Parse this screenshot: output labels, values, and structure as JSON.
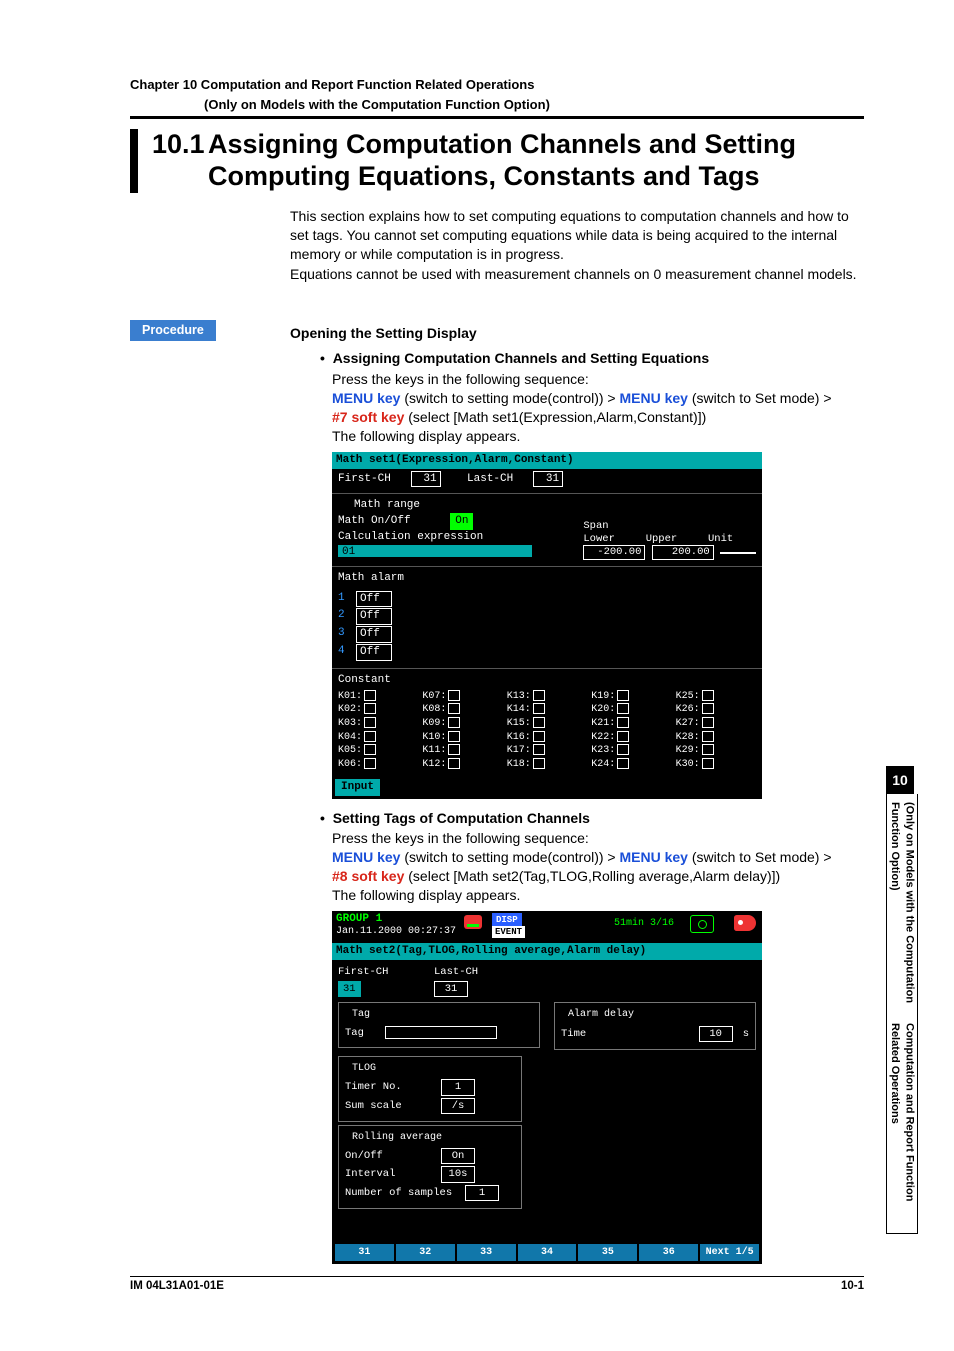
{
  "running_header": {
    "line1": "Chapter 10 Computation and Report Function Related Operations",
    "line2": "(Only on Models with the Computation Function Option)"
  },
  "section": {
    "number": "10.1",
    "title_line1": "Assigning Computation Channels and Setting",
    "title_line2": "Computing Equations, Constants and Tags"
  },
  "intro": {
    "p1": "This section explains how to set computing equations to computation channels and how to set tags.  You cannot set computing equations while data is being acquired to the internal memory or while computation is in progress.",
    "p2": "Equations cannot be used with measurement channels on 0 measurement channel models."
  },
  "procedure_label": "Procedure",
  "opening_heading": "Opening the Setting Display",
  "bullet1": {
    "title": "Assigning Computation Channels and Setting Equations",
    "text1": "Press the keys in the following sequence:",
    "seq_menu1": "MENU key",
    "seq_t1": " (switch to setting mode(control)) > ",
    "seq_menu2": "MENU key",
    "seq_t2": " (switch to Set mode) > ",
    "seq_soft": "#7 soft key",
    "seq_t3": " (select [Math set1(Expression,Alarm,Constant)])",
    "text2": "The following display appears."
  },
  "lcd1": {
    "title_bar": "Math set1(Expression,Alarm,Constant)",
    "first_ch_label": "First-CH",
    "first_ch_value": "31",
    "last_ch_label": "Last-CH",
    "last_ch_value": "31",
    "math_range_label": "Math range",
    "math_onoff_label": "Math On/Off",
    "math_onoff_value": "On",
    "calc_label": "Calculation expression",
    "calc_field": "01",
    "span_label": "Span",
    "lower_label": "Lower",
    "lower_value": "-200.00",
    "upper_label": "Upper",
    "upper_value": "200.00",
    "unit_label": "Unit",
    "alarm_label": "Math alarm",
    "alarms": [
      {
        "n": "1",
        "state": "Off"
      },
      {
        "n": "2",
        "state": "Off"
      },
      {
        "n": "3",
        "state": "Off"
      },
      {
        "n": "4",
        "state": "Off"
      }
    ],
    "constant_label": "Constant",
    "k_labels": [
      "K01:",
      "K02:",
      "K03:",
      "K04:",
      "K05:",
      "K06:",
      "K07:",
      "K08:",
      "K09:",
      "K10:",
      "K11:",
      "K12:",
      "K13:",
      "K14:",
      "K15:",
      "K16:",
      "K17:",
      "K18:",
      "K19:",
      "K20:",
      "K21:",
      "K22:",
      "K23:",
      "K24:",
      "K25:",
      "K26:",
      "K27:",
      "K28:",
      "K29:",
      "K30:"
    ],
    "input_label": "Input"
  },
  "bullet2": {
    "title": "Setting Tags of Computation Channels",
    "text1": "Press the keys in the following sequence:",
    "seq_menu1": "MENU key",
    "seq_t1": " (switch to setting mode(control)) > ",
    "seq_menu2": "MENU key",
    "seq_t2": " (switch to Set mode) > ",
    "seq_soft": "#8 soft key",
    "seq_t3": " (select [Math set2(Tag,TLOG,Rolling average,Alarm delay)])",
    "text2": "The following display appears."
  },
  "lcd2": {
    "group": "GROUP 1",
    "datetime": "Jan.11.2000 00:27:37",
    "disp_btn": "DISP",
    "event_btn": "EVENT",
    "time_status": "51min  3/16",
    "title_bar": "Math set2(Tag,TLOG,Rolling average,Alarm delay)",
    "first_ch_label": "First-CH",
    "first_ch_value": "31",
    "last_ch_label": "Last-CH",
    "last_ch_value": "31",
    "tag_legend": "Tag",
    "tag_label": "Tag",
    "alarm_delay_legend": "Alarm delay",
    "alarm_time_label": "Time",
    "alarm_time_value": "10",
    "alarm_time_unit": "s",
    "tlog_legend": "TLOG",
    "timer_label": "Timer No.",
    "timer_value": "1",
    "sum_label": "Sum scale",
    "sum_value": "/s",
    "roll_legend": "Rolling average",
    "roll_onoff_label": "On/Off",
    "roll_onoff_value": "On",
    "roll_interval_label": "Interval",
    "roll_interval_value": "10s",
    "roll_samples_label": "Number of samples",
    "roll_samples_value": "1",
    "softkeys": [
      "31",
      "32",
      "33",
      "34",
      "35",
      "36",
      "Next 1/5"
    ]
  },
  "side_tab": {
    "number": "10",
    "line1": "Computation and Report Function Related Operations",
    "line2": "(Only on Models with the Computation Function Option)"
  },
  "footer": {
    "left": "IM 04L31A01-01E",
    "right": "10-1"
  }
}
